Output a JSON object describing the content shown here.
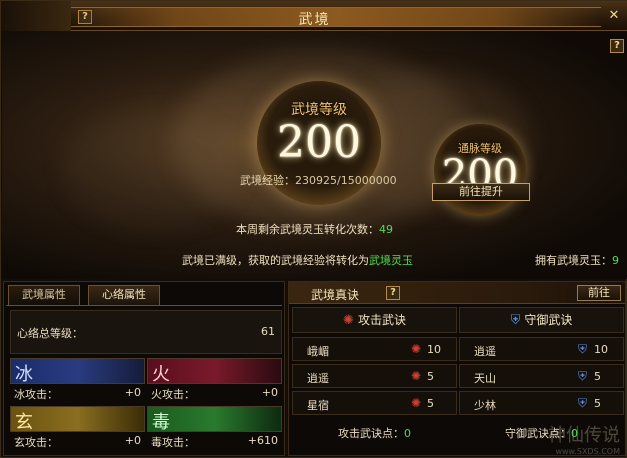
{
  "window": {
    "title": "武境",
    "help_label": "?",
    "close_label": "✕"
  },
  "realm": {
    "level_label": "武境等级",
    "level_value": "200",
    "meridian_label": "通脉等级",
    "meridian_value": "200",
    "exp_label": "武境经验：",
    "exp_value": "230925/15000000",
    "goto_button": "前往提升",
    "weekly_text": "本周剩余武境灵玉转化次数：",
    "weekly_value": "49",
    "maxed_text": "武境已满级，获取的武境经验将转化为",
    "maxed_item": "武境灵玉",
    "own_label": "拥有武境灵玉：",
    "own_value": "9"
  },
  "attributes": {
    "tabs": [
      {
        "label": "武境属性"
      },
      {
        "label": "心络属性"
      }
    ],
    "total_label": "心络总等级：",
    "total_value": "61",
    "elements": [
      {
        "glyph": "冰",
        "label": "冰攻击：",
        "value": "+0",
        "color": "#2a3c80"
      },
      {
        "glyph": "火",
        "label": "火攻击：",
        "value": "+0",
        "color": "#7a1a2a"
      },
      {
        "glyph": "玄",
        "label": "玄攻击：",
        "value": "+0",
        "color": "#8a6e20"
      },
      {
        "glyph": "毒",
        "label": "毒攻击：",
        "value": "+610",
        "color": "#2a7a2e"
      }
    ]
  },
  "skills": {
    "title": "武境真诀",
    "goto_label": "前往",
    "attack": {
      "title": "攻击武诀",
      "icon": "flame-sigil-icon",
      "items": [
        {
          "name": "峨嵋",
          "level": "10"
        },
        {
          "name": "逍遥",
          "level": "5"
        },
        {
          "name": "星宿",
          "level": "5"
        }
      ],
      "points_label": "攻击武诀点：",
      "points_value": "0"
    },
    "defense": {
      "title": "守御武诀",
      "icon": "shield-icon",
      "items": [
        {
          "name": "逍遥",
          "level": "10"
        },
        {
          "name": "天山",
          "level": "5"
        },
        {
          "name": "少林",
          "level": "5"
        }
      ],
      "points_label": "守御武诀点：",
      "points_value": "0"
    }
  },
  "watermark": {
    "text": "神仙传说",
    "url": "www.SXDS.COM"
  }
}
